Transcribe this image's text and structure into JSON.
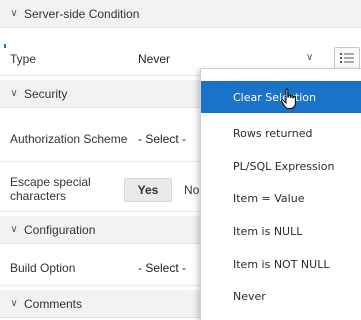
{
  "sections": {
    "server_side_condition": "Server-side Condition",
    "security": "Security",
    "configuration": "Configuration",
    "comments": "Comments"
  },
  "type_row": {
    "label": "Type",
    "value": "Never"
  },
  "authorization_row": {
    "label": "Authorization Scheme",
    "value": "- Select -"
  },
  "escape_row": {
    "label": "Escape special characters",
    "yes_label": "Yes",
    "no_label": "No"
  },
  "build_option_row": {
    "label": "Build Option",
    "value": "- Select -"
  },
  "popup": {
    "items": [
      {
        "label": "Clear Selection",
        "selected": true
      },
      {
        "label": "Rows returned"
      },
      {
        "label": "PL/SQL Expression"
      },
      {
        "label": "Item = Value"
      },
      {
        "label": "Item is NULL"
      },
      {
        "label": "Item is NOT NULL"
      },
      {
        "label": "Never"
      }
    ]
  },
  "colors": {
    "selected_bg": "#1a73c9",
    "header_bg": "#f2f2f2"
  },
  "icons": {
    "chevron": "chevron-down-icon",
    "list": "list-icon",
    "cursor": "hand-pointer-icon"
  }
}
